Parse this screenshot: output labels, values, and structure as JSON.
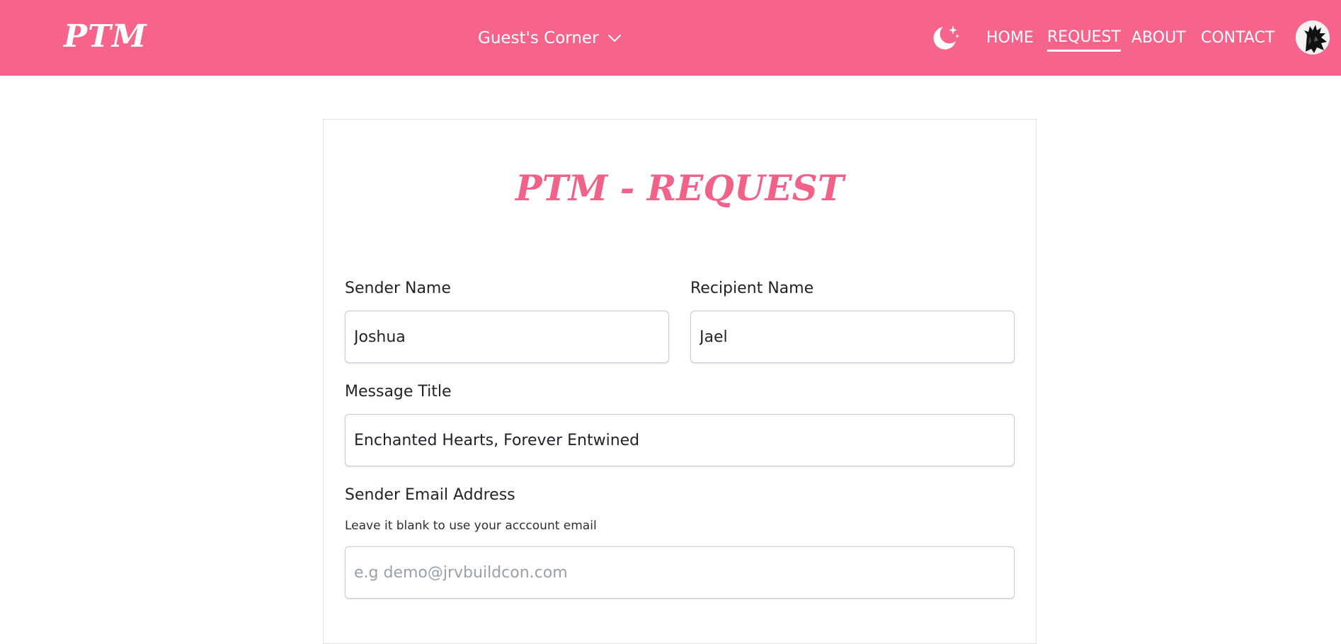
{
  "header": {
    "logo": "PTM",
    "guest_menu_label": "Guest's Corner",
    "nav": [
      {
        "label": "HOME",
        "active": false
      },
      {
        "label": "REQUEST",
        "active": true
      },
      {
        "label": "ABOUT",
        "active": false
      },
      {
        "label": "CONTACT",
        "active": false
      }
    ],
    "theme_toggle_icon": "moon-stars-icon",
    "background_color": "#f6648c"
  },
  "form": {
    "title": "PTM - REQUEST",
    "sender_name": {
      "label": "Sender Name",
      "value": "Joshua"
    },
    "recipient_name": {
      "label": "Recipient Name",
      "value": "Jael"
    },
    "message_title": {
      "label": "Message Title",
      "value": "Enchanted Hearts, Forever Entwined"
    },
    "sender_email": {
      "label": "Sender Email Address",
      "hint": "Leave it blank to use your acccount email",
      "placeholder": "e.g demo@jrvbuildcon.com",
      "value": ""
    }
  }
}
